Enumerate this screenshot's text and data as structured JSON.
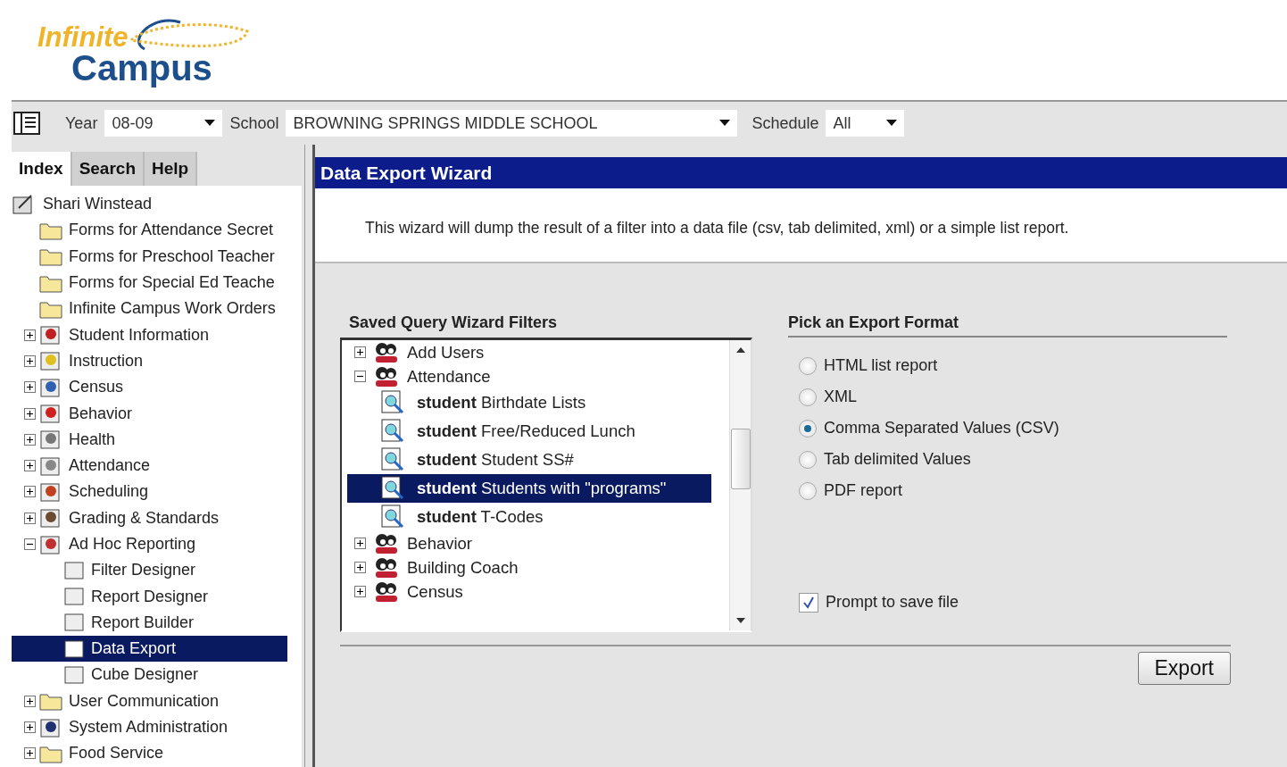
{
  "logo": {
    "word_1": "Infinite",
    "word_2": "Campus"
  },
  "toolbar": {
    "year_label": "Year",
    "year": "08-09",
    "school_label": "School",
    "school": "BROWNING SPRINGS MIDDLE SCHOOL",
    "schedule_label": "Schedule",
    "schedule": "All"
  },
  "sidebar": {
    "tabs": [
      {
        "label": "Index",
        "selected": true
      },
      {
        "label": "Search",
        "selected": false
      },
      {
        "label": "Help",
        "selected": false
      }
    ],
    "user": "Shari Winstead",
    "items": [
      {
        "label": "Forms for Attendance Secret",
        "kind": "folder"
      },
      {
        "label": "Forms for Preschool Teacher",
        "kind": "folder"
      },
      {
        "label": "Forms for Special Ed Teache",
        "kind": "folder"
      },
      {
        "label": "Infinite Campus Work Orders",
        "kind": "folder"
      },
      {
        "label": "Student Information",
        "kind": "module",
        "expanded": false
      },
      {
        "label": "Instruction",
        "kind": "module",
        "expanded": false
      },
      {
        "label": "Census",
        "kind": "module",
        "expanded": false
      },
      {
        "label": "Behavior",
        "kind": "module",
        "expanded": false
      },
      {
        "label": "Health",
        "kind": "module",
        "expanded": false
      },
      {
        "label": "Attendance",
        "kind": "module",
        "expanded": false
      },
      {
        "label": "Scheduling",
        "kind": "module",
        "expanded": false
      },
      {
        "label": "Grading & Standards",
        "kind": "module",
        "expanded": false
      },
      {
        "label": "Ad Hoc Reporting",
        "kind": "module",
        "expanded": true,
        "children": [
          {
            "label": "Filter Designer",
            "selected": false
          },
          {
            "label": "Report Designer",
            "selected": false
          },
          {
            "label": "Report Builder",
            "selected": false
          },
          {
            "label": "Data Export",
            "selected": true
          },
          {
            "label": "Cube Designer",
            "selected": false
          }
        ]
      },
      {
        "label": "User Communication",
        "kind": "folder",
        "expanded": false
      },
      {
        "label": "System Administration",
        "kind": "module",
        "expanded": false
      },
      {
        "label": "Food Service",
        "kind": "folder",
        "expanded": false
      }
    ]
  },
  "main": {
    "title": "Data Export Wizard",
    "description": "This wizard will dump the result of a filter into a data file (csv, tab delimited, xml) or a simple list report.",
    "filters": {
      "heading": "Saved Query Wizard Filters",
      "items": [
        {
          "label": "Add Users",
          "kind": "group",
          "expanded": false
        },
        {
          "label": "Attendance",
          "kind": "group",
          "expanded": true,
          "children": [
            {
              "label": "**student** Birthdate Lists",
              "selected": false
            },
            {
              "label": "**student** Free/Reduced Lunch",
              "selected": false
            },
            {
              "label": "**student** Student SS#",
              "selected": false
            },
            {
              "label": "**student** Students with \"programs\"",
              "selected": true
            },
            {
              "label": "**student** T-Codes",
              "selected": false
            }
          ]
        },
        {
          "label": "Behavior",
          "kind": "group",
          "expanded": false
        },
        {
          "label": "Building Coach",
          "kind": "group",
          "expanded": false
        },
        {
          "label": "Census",
          "kind": "group",
          "expanded": false
        }
      ]
    },
    "format": {
      "heading": "Pick an Export Format",
      "options": [
        {
          "label": "HTML list report",
          "selected": false
        },
        {
          "label": "XML",
          "selected": false
        },
        {
          "label": "Comma Separated Values (CSV)",
          "selected": true
        },
        {
          "label": "Tab delimited Values",
          "selected": false
        },
        {
          "label": "PDF report",
          "selected": false
        }
      ],
      "prompt": {
        "label": "Prompt to save file",
        "checked": true
      }
    },
    "export_button": "Export"
  }
}
